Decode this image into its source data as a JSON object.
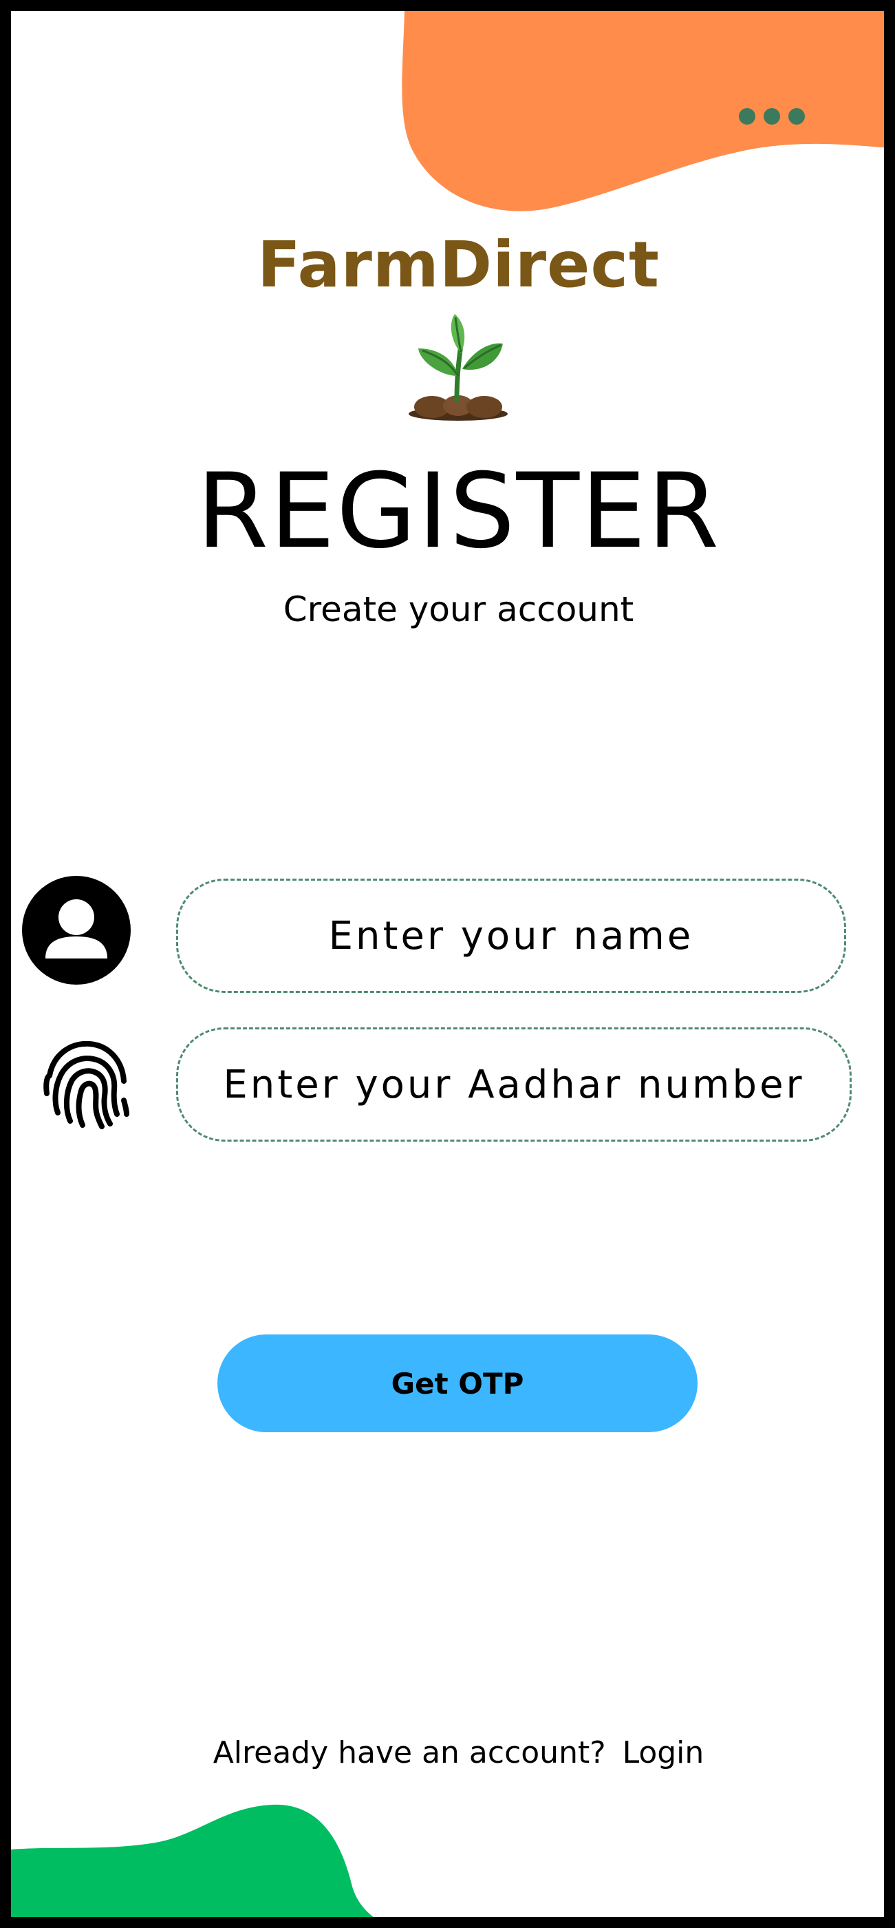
{
  "app": {
    "brand_name": "FarmDirect"
  },
  "header": {
    "title": "REGISTER",
    "subtitle": "Create your account",
    "menu_icon": "more-horizontal-icon"
  },
  "form": {
    "name_field": {
      "placeholder": "Enter your name",
      "value": "",
      "icon": "user-avatar-icon"
    },
    "aadhar_field": {
      "placeholder": "Enter your Aadhar number",
      "value": "",
      "icon": "fingerprint-icon"
    },
    "submit_label": "Get OTP"
  },
  "footer": {
    "prompt": "Already have an account?",
    "login_label": "Login"
  },
  "colors": {
    "top_blob": "#ff8c4b",
    "bottom_blob": "#00bd62",
    "button": "#3bb6ff",
    "brand": "#7a5716",
    "dots": "#3b7a5c",
    "field_border": "#4f8b6f"
  }
}
